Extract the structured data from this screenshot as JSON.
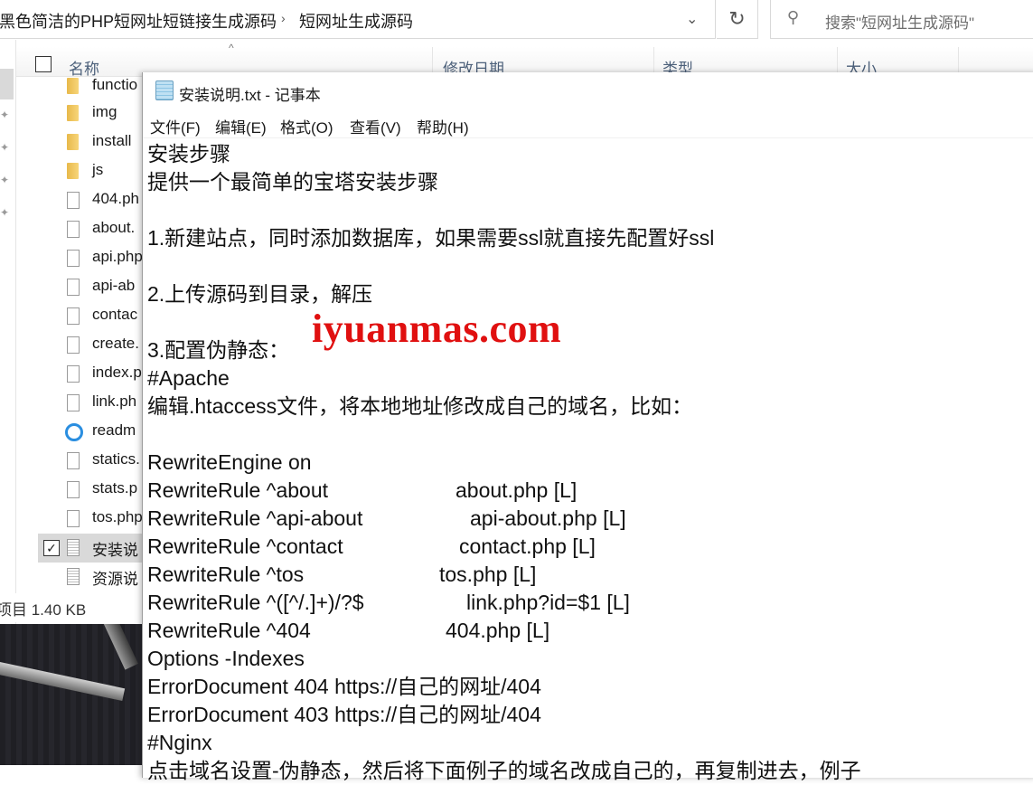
{
  "explorer": {
    "breadcrumb": [
      "黑色简洁的PHP短网址短链接生成源码",
      "短网址生成源码"
    ],
    "breadcrumb_separator": "›",
    "address_dropdown_icon": "chevron-down-icon",
    "refresh_icon": "refresh-icon",
    "search_placeholder": "搜索\"短网址生成源码\"",
    "columns": [
      "名称",
      "修改日期",
      "类型",
      "大小"
    ],
    "sort_indicator": "^",
    "files": [
      {
        "name": "functio",
        "type": "folder"
      },
      {
        "name": "img",
        "type": "folder"
      },
      {
        "name": "install",
        "type": "folder"
      },
      {
        "name": "js",
        "type": "folder"
      },
      {
        "name": "404.ph",
        "type": "file"
      },
      {
        "name": "about.",
        "type": "file"
      },
      {
        "name": "api.php",
        "type": "file"
      },
      {
        "name": "api-ab",
        "type": "file"
      },
      {
        "name": "contac",
        "type": "file"
      },
      {
        "name": "create.",
        "type": "file"
      },
      {
        "name": "index.p",
        "type": "file"
      },
      {
        "name": "link.ph",
        "type": "file"
      },
      {
        "name": "readm",
        "type": "html"
      },
      {
        "name": "statics.",
        "type": "file"
      },
      {
        "name": "stats.p",
        "type": "file"
      },
      {
        "name": "tos.php",
        "type": "file"
      },
      {
        "name": "安装说",
        "type": "text",
        "selected": true,
        "checked": true
      },
      {
        "name": "资源说",
        "type": "text"
      }
    ],
    "status_text": "项目 1.40 KB"
  },
  "notepad": {
    "title": "安装说明.txt - 记事本",
    "menu": [
      "文件(F)",
      "编辑(E)",
      "格式(O)",
      "查看(V)",
      "帮助(H)"
    ],
    "lines": [
      {
        "text": "安装步骤"
      },
      {
        "text": "提供一个最简单的宝塔安装步骤"
      },
      {
        "text": ""
      },
      {
        "text": "1.新建站点，同时添加数据库，如果需要ssl就直接先配置好ssl"
      },
      {
        "text": ""
      },
      {
        "text": "2.上传源码到目录，解压"
      },
      {
        "text": ""
      },
      {
        "text": "3.配置伪静态："
      },
      {
        "text": "#Apache"
      },
      {
        "text": "编辑.htaccess文件，将本地地址修改成自己的域名，比如："
      },
      {
        "text": ""
      },
      {
        "text": "RewriteEngine on"
      },
      {
        "text": "RewriteRule ^about",
        "target": "about.php [L]"
      },
      {
        "text": "RewriteRule ^api-about",
        "target": "api-about.php [L]"
      },
      {
        "text": "RewriteRule ^contact",
        "target": "contact.php [L]"
      },
      {
        "text": "RewriteRule ^tos",
        "target": "tos.php [L]"
      },
      {
        "text": "RewriteRule ^([^/.]+)/?$",
        "target": "link.php?id=$1 [L]"
      },
      {
        "text": "RewriteRule ^404",
        "target": "404.php [L]"
      },
      {
        "text": "Options -Indexes"
      },
      {
        "text": "ErrorDocument 404 https://自己的网址/404"
      },
      {
        "text": "ErrorDocument 403 https://自己的网址/404"
      },
      {
        "text": "#Nginx"
      },
      {
        "text": "点击域名设置-伪静态，然后将下面例子的域名改成自己的，再复制进去，例子"
      }
    ]
  },
  "watermark": "iyuanmas.com",
  "colors": {
    "watermark": "#e01010",
    "column_header_text": "#4c607a",
    "selection": "#d9d9d9"
  }
}
